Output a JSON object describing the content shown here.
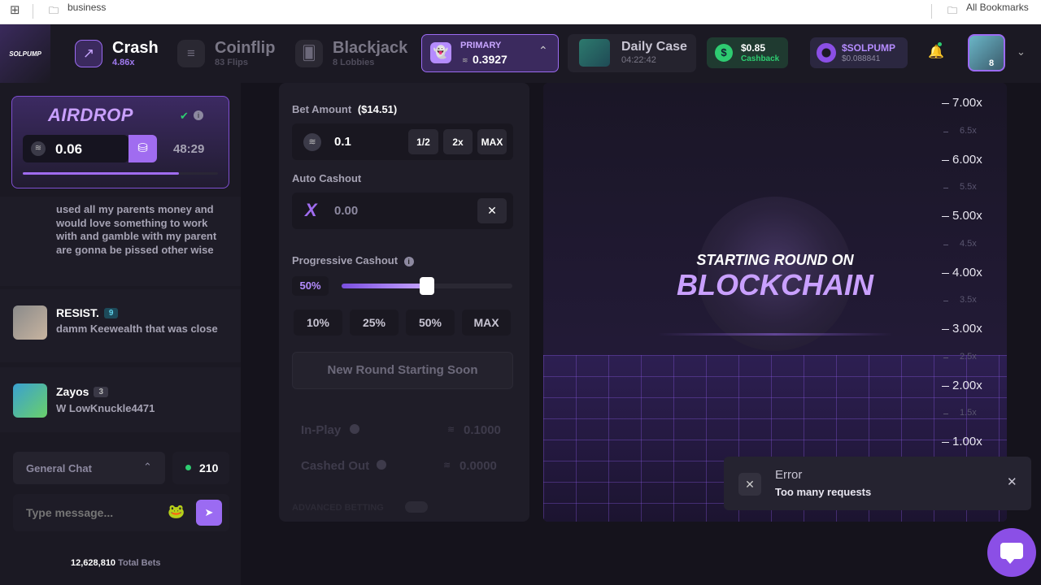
{
  "bookmarks": {
    "folder": "business",
    "all": "All Bookmarks"
  },
  "nav": {
    "logo": "SOLPUMP",
    "crash": {
      "title": "Crash",
      "sub": "4.86x"
    },
    "coinflip": {
      "title": "Coinflip",
      "sub": "83 Flips"
    },
    "blackjack": {
      "title": "Blackjack",
      "sub": "8 Lobbies"
    },
    "primary": {
      "label": "PRIMARY",
      "value": "0.3927"
    },
    "daily": {
      "title": "Daily Case",
      "timer": "04:22:42"
    },
    "cashback": {
      "value": "$0.85",
      "label": "Cashback"
    },
    "token": {
      "name": "$SOLPUMP",
      "price": "$0.088841"
    },
    "level": "8"
  },
  "airdrop": {
    "title": "AIRDROP",
    "amount": "0.06",
    "timer": "48:29",
    "progress": 0.8
  },
  "chat": {
    "messages": [
      {
        "user": "",
        "text": "used all my parents money and would love something to work with and gamble with my parent are gonna be pissed other wise"
      },
      {
        "user": "RESIST.",
        "level": "9",
        "text": "damm Keewealth that was close"
      },
      {
        "user": "Zayos",
        "level": "3",
        "text": "W LowKnuckle4471"
      }
    ],
    "channel": "General Chat",
    "online": "210",
    "placeholder": "Type message...",
    "total_bets": "12,628,810",
    "total_bets_label": "Total Bets"
  },
  "bet": {
    "amount_label": "Bet Amount",
    "amount_usd": "($14.51)",
    "amount": "0.1",
    "half": "1/2",
    "double": "2x",
    "max": "MAX",
    "auto_label": "Auto Cashout",
    "auto_value": "0.00",
    "prog_label": "Progressive Cashout",
    "prog_value": "50%",
    "prog_fraction": 0.5,
    "presets": [
      "10%",
      "25%",
      "50%",
      "MAX"
    ],
    "button": "New Round Starting Soon",
    "in_play_label": "In-Play",
    "in_play_value": "0.1000",
    "cashed_label": "Cashed Out",
    "cashed_value": "0.0000",
    "advanced": "ADVANCED BETTING"
  },
  "game": {
    "line1": "STARTING ROUND ON",
    "line2": "BLOCKCHAIN",
    "ticks": [
      "7.00x",
      "6.5x",
      "6.00x",
      "5.5x",
      "5.00x",
      "4.5x",
      "4.00x",
      "3.5x",
      "3.00x",
      "2.5x",
      "2.00x",
      "1.5x",
      "1.00x"
    ]
  },
  "toast": {
    "title": "Error",
    "message": "Too many requests"
  },
  "colors": {
    "accent": "#9b6bf2",
    "green": "#2ecc71",
    "bg": "#15131c"
  }
}
